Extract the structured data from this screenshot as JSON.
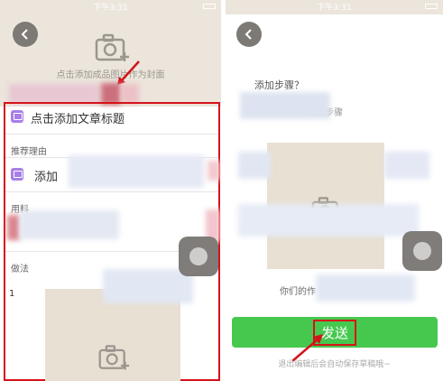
{
  "left_phone": {
    "status_time": "下午3:31",
    "cover_hint": "点击添加成品图片作为封面",
    "title_placeholder": "点击添加文章标题",
    "reason_label": "推荐理由",
    "reason_placeholder": "添加",
    "ingredients_label": "用料",
    "method_label": "做法",
    "step_number": "1"
  },
  "right_phone": {
    "status_time": "下午3:31",
    "add_step_text": "添加步骤？",
    "add_step_link": "添加步骤",
    "tips_text": "你们的作",
    "send_label": "发送",
    "autosave_hint": "退出编辑后会自动保存草稿哦~"
  },
  "colors": {
    "highlight_red": "#d5121a",
    "send_green": "#46c84f",
    "icon_purple": "#a77fe6"
  }
}
